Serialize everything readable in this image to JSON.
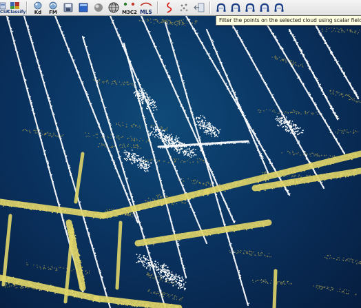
{
  "toolbar": {
    "buttons": [
      {
        "id": "csf-filter",
        "label": "CSF",
        "icon": "csf-filter-icon"
      },
      {
        "id": "classify",
        "label": "Classify",
        "icon": "classify-icon"
      },
      {
        "id": "kd",
        "label": "Kd",
        "icon": "kd-tree-icon"
      },
      {
        "id": "fm",
        "label": "FM",
        "icon": "fast-marching-icon"
      },
      {
        "id": "save",
        "label": "",
        "icon": "save-icon"
      },
      {
        "id": "blue-panel",
        "label": "",
        "icon": "panel-icon"
      },
      {
        "id": "sphere",
        "label": "",
        "icon": "sphere-icon"
      },
      {
        "id": "globe",
        "label": "",
        "icon": "globe-mesh-icon"
      },
      {
        "id": "m3c2",
        "label": "M3C2",
        "icon": "m3c2-icon"
      },
      {
        "id": "mls",
        "label": "MLS",
        "icon": "mls-icon"
      },
      {
        "id": "curve",
        "label": "",
        "icon": "red-curve-icon"
      },
      {
        "id": "registration",
        "label": "",
        "icon": "registration-icon"
      },
      {
        "id": "arrow-panel",
        "label": "",
        "icon": "arrow-left-panel-icon"
      },
      {
        "id": "filter-sf-1",
        "label": "",
        "icon": "filter-scalar-field-icon"
      },
      {
        "id": "filter-sf-2",
        "label": "",
        "icon": "filter-scalar-field-icon"
      },
      {
        "id": "filter-sf-3",
        "label": "",
        "icon": "filter-scalar-field-icon"
      },
      {
        "id": "filter-sf-4",
        "label": "",
        "icon": "filter-scalar-field-icon"
      },
      {
        "id": "filter-sf-5",
        "label": "",
        "icon": "filter-scalar-field-icon"
      }
    ]
  },
  "tooltip": {
    "text": "Filter the points on the selected cloud using scalar field"
  },
  "viewport": {
    "name": "3D point cloud view",
    "background_color": "#0b3765",
    "point_colors": [
      "#ffffff",
      "#e0d56a",
      "#8a8850"
    ]
  }
}
